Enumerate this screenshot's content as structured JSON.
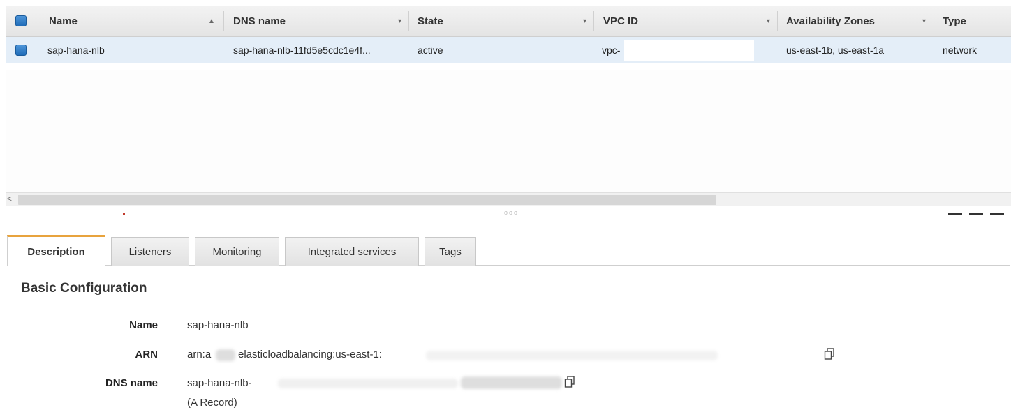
{
  "table": {
    "columns": [
      {
        "label": "Name"
      },
      {
        "label": "DNS name"
      },
      {
        "label": "State"
      },
      {
        "label": "VPC ID"
      },
      {
        "label": "Availability Zones"
      },
      {
        "label": "Type"
      }
    ],
    "sort_indicator": "▲",
    "filter_indicator": "▾",
    "rows": [
      {
        "name": "sap-hana-nlb",
        "dns_name": "sap-hana-nlb-11fd5e5cdc1e4f...",
        "state": "active",
        "vpc_id": "vpc-",
        "availability_zones": "us-east-1b, us-east-1a",
        "type": "network"
      }
    ]
  },
  "scrollbar": {
    "left_arrow": "<"
  },
  "splitter": {
    "grip": "ooo"
  },
  "tabs": [
    {
      "label": "Description",
      "active": true
    },
    {
      "label": "Listeners"
    },
    {
      "label": "Monitoring"
    },
    {
      "label": "Integrated services"
    },
    {
      "label": "Tags"
    }
  ],
  "details": {
    "section_title": "Basic Configuration",
    "fields": {
      "name": {
        "label": "Name",
        "value": "sap-hana-nlb"
      },
      "arn": {
        "label": "ARN",
        "value_prefix": "arn:a",
        "value_mid": "elasticloadbalancing:us-east-1:"
      },
      "dns": {
        "label": "DNS name",
        "value": "sap-hana-nlb-",
        "note": "(A Record)"
      }
    }
  },
  "icons": {
    "copy": "copy-to-clipboard-icon"
  },
  "colors": {
    "accent_tab": "#e8a33d",
    "checkbox": "#1f6cb8",
    "selected_row": "#e4eef8"
  }
}
